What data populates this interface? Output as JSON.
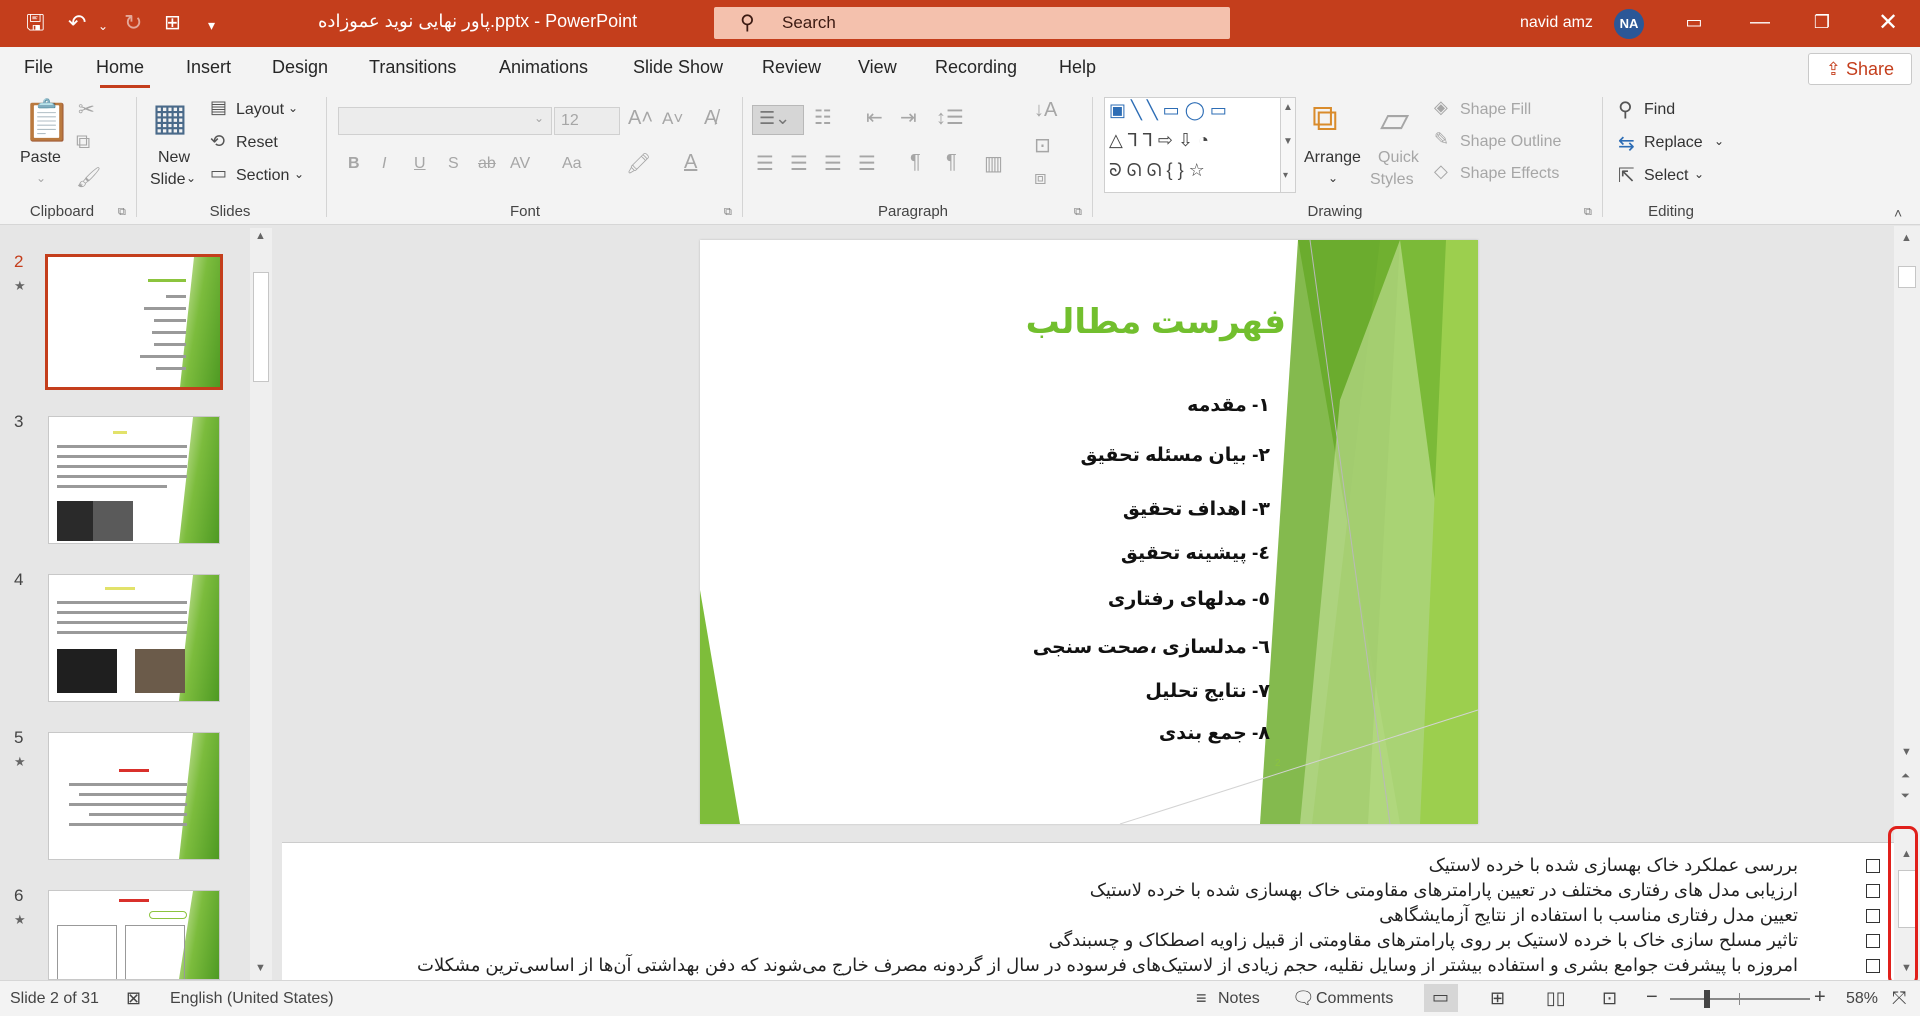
{
  "titlebar": {
    "doc_title": "پاور نهایی نوید عموزاده.pptx  -  PowerPoint",
    "search_placeholder": "Search",
    "user_name": "navid amz",
    "user_initials": "NA"
  },
  "tabs": [
    "File",
    "Home",
    "Insert",
    "Design",
    "Transitions",
    "Animations",
    "Slide Show",
    "Review",
    "View",
    "Recording",
    "Help"
  ],
  "share_label": "Share",
  "ribbon": {
    "clipboard": {
      "label": "Clipboard",
      "paste": "Paste"
    },
    "slides": {
      "label": "Slides",
      "new_slide_1": "New",
      "new_slide_2": "Slide",
      "layout": "Layout",
      "reset": "Reset",
      "section": "Section"
    },
    "font": {
      "label": "Font",
      "font_size": "12",
      "buttons": [
        "B",
        "I",
        "U",
        "S",
        "ab",
        "AV",
        "Aa"
      ]
    },
    "paragraph": {
      "label": "Paragraph"
    },
    "drawing": {
      "label": "Drawing",
      "arrange": "Arrange",
      "quick_styles_1": "Quick",
      "quick_styles_2": "Styles",
      "shape_fill": "Shape Fill",
      "shape_outline": "Shape Outline",
      "shape_effects": "Shape Effects"
    },
    "editing": {
      "label": "Editing",
      "find": "Find",
      "replace": "Replace",
      "select": "Select"
    }
  },
  "thumbnails": [
    {
      "num": "2",
      "star": "★",
      "selected": true
    },
    {
      "num": "3",
      "star": "",
      "selected": false
    },
    {
      "num": "4",
      "star": "",
      "selected": false
    },
    {
      "num": "5",
      "star": "★",
      "selected": false
    },
    {
      "num": "6",
      "star": "★",
      "selected": false
    }
  ],
  "slide": {
    "title": "فهرست مطالب",
    "items": [
      "۱- مقدمه",
      "۲- بیان مسئله تحقیق",
      "۳- اهداف تحقیق",
      "٤- پیشینه تحقیق",
      "٥- مدلهای رفتاری",
      "٦- مدلسازی ،صحت سنجی",
      "۷- نتایج تحلیل",
      "۸- جمع بندی"
    ],
    "page_number": "2"
  },
  "notes": [
    "بررسی عملکرد خاک بهسازی شده با خرده لاستیک",
    "ارزیابی مدل های رفتاری مختلف در تعیین پارامترهای مقاومتی خاک بهسازی شده با خرده لاستیک",
    "تعیین مدل رفتاری مناسب با استفاده از نتایج آزمایشگاهی",
    "تاثیر مسلح سازی خاک با خرده لاستیک بر روی پارامترهای مقاومتی از قبیل زاویه اصطکاک و چسبندگی",
    "امروزه با پیشرفت جوامع بشری و استفاده بیشتر از وسایل نقلیه، حجم زیادی از لاستیک‌های فرسوده در سال از گردونه مصرف خارج می‌شوند که دفن بهداشتی آن‌ها از اساسی‌ترین مشکلات"
  ],
  "statusbar": {
    "slide_info": "Slide 2 of 31",
    "language": "English (United States)",
    "notes": "Notes",
    "comments": "Comments",
    "zoom": "58%"
  }
}
